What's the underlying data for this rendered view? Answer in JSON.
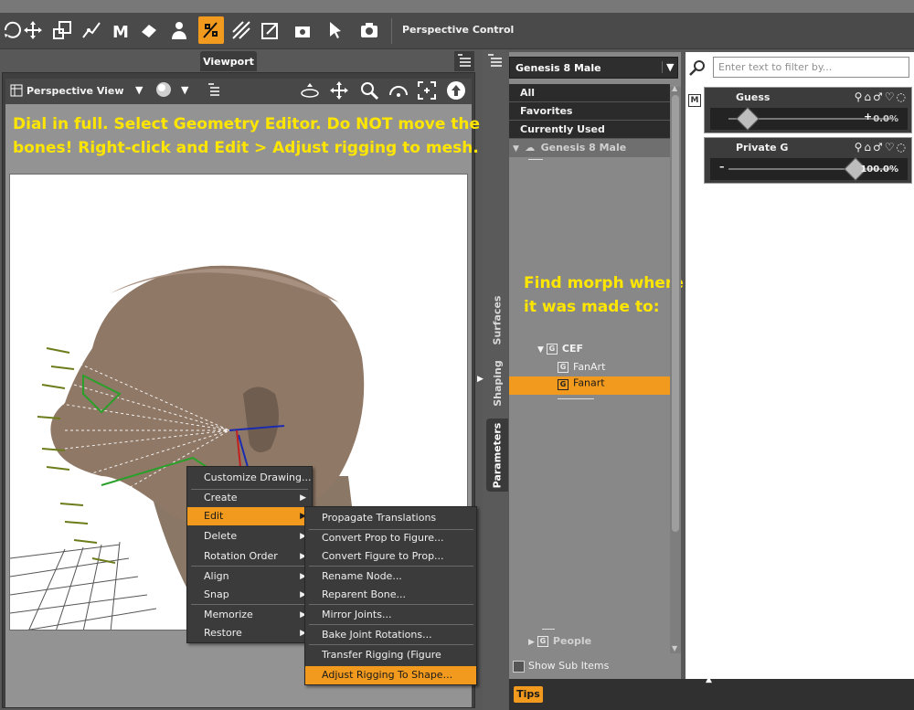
{
  "toolbar": {
    "icons": [
      "rotate-icon",
      "move-icon",
      "scale-icon",
      "joint-icon",
      "morph-icon",
      "surface-icon",
      "figure-icon",
      "geometry-editor-icon",
      "node-weight-icon",
      "active-pose-icon",
      "camera-icon",
      "scene-icon",
      "render-icon"
    ],
    "active_tool": "geometry-editor-icon",
    "current_tool_label": "Perspective Control"
  },
  "viewport": {
    "tab_label": "Viewport",
    "view_name": "Perspective View",
    "instruction_line1": "Dial in full. Select Geometry Editor. Do NOT move the",
    "instruction_line2": "bones!  Right-click and Edit > Adjust rigging to mesh."
  },
  "context_menu": {
    "items": [
      "Customize Drawing...",
      "Create",
      "Edit",
      "Delete",
      "Rotation Order",
      "Align",
      "Snap",
      "Memorize",
      "Restore"
    ],
    "highlighted": "Edit"
  },
  "edit_submenu": {
    "items": [
      "Propagate Translations",
      "Convert Prop to Figure...",
      "Convert Figure to Prop...",
      "Rename Node...",
      "Reparent Bone...",
      "Mirror Joints...",
      "Bake Joint Rotations...",
      "Transfer Rigging (Figure Space)",
      "Adjust Rigging To Shape..."
    ],
    "highlighted": "Adjust Rigging To Shape..."
  },
  "side_tabs": [
    "Surfaces",
    "Shaping",
    "Parameters"
  ],
  "category_panel": {
    "figure_select": "Genesis 8 Male",
    "rows": [
      "All",
      "Favorites",
      "Currently Used"
    ],
    "group": "Genesis 8 Male",
    "annotation_line1": "Find morph where",
    "annotation_line2": "it was made to:",
    "tree": {
      "parent": "CEF",
      "children": [
        "FanArt",
        "Fanart"
      ],
      "selected": "Fanart",
      "bottom_group": "People"
    },
    "show_sub_items": "Show Sub Items"
  },
  "tips_label": "Tips",
  "parameters": {
    "filter_placeholder": "Enter text to filter by...",
    "items": [
      {
        "name": "Guess",
        "value": "0.0%",
        "fraction": 0.0
      },
      {
        "name": "Private G",
        "value": "100.0%",
        "fraction": 1.0
      }
    ]
  },
  "colors": {
    "accent": "#f29a1e",
    "annotation": "#ffe600"
  }
}
